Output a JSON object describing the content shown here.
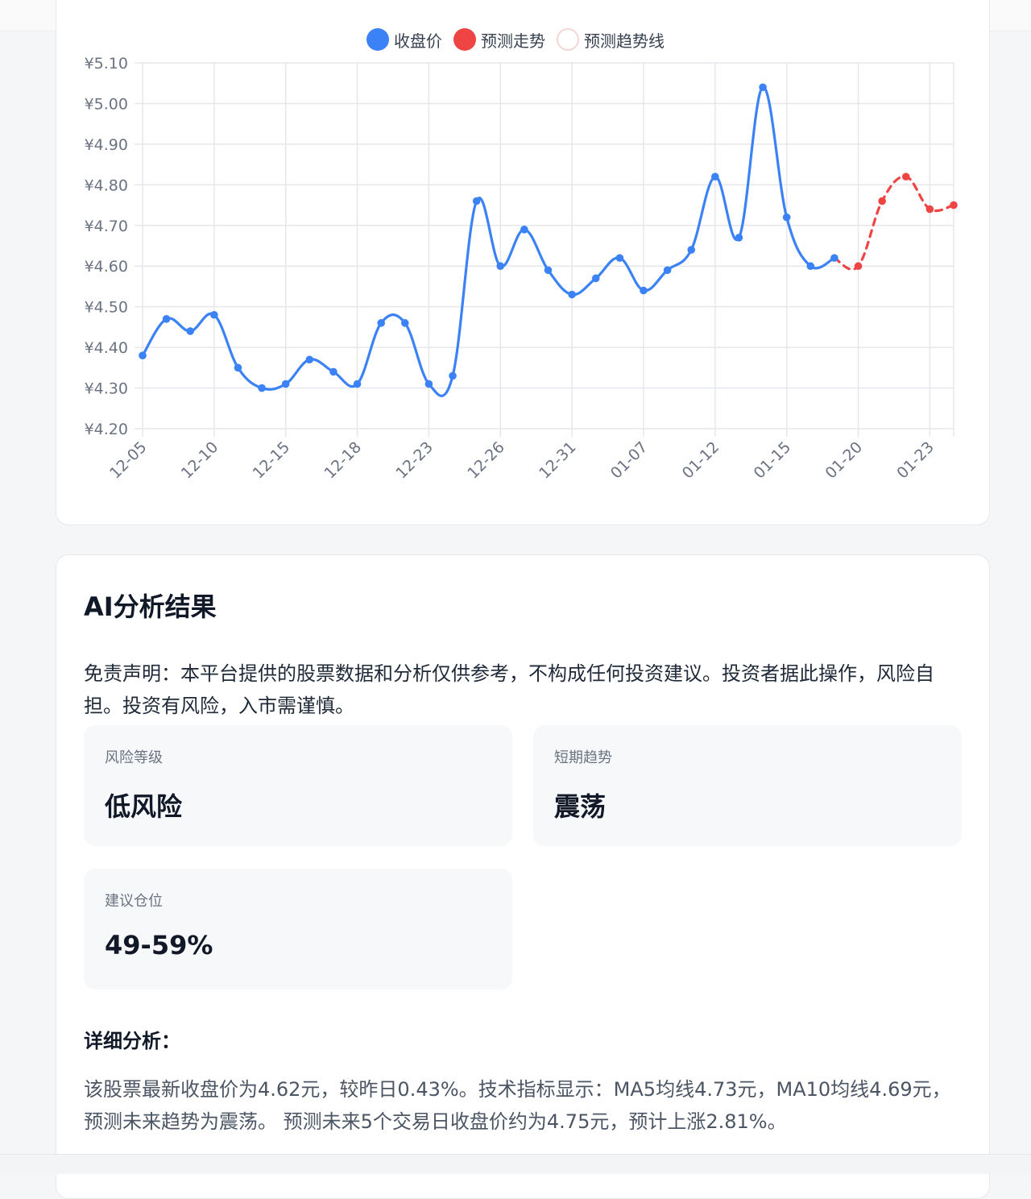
{
  "legend": {
    "items": [
      {
        "label": "收盘价",
        "color": "#3b82f6",
        "style": "filled"
      },
      {
        "label": "预测走势",
        "color": "#ef4444",
        "style": "filled"
      },
      {
        "label": "预测趋势线",
        "color": "#f3d6d6",
        "style": "hollow"
      }
    ]
  },
  "chart_data": {
    "type": "line",
    "ylim": [
      4.2,
      5.1
    ],
    "y_ticks": [
      "¥4.20",
      "¥4.30",
      "¥4.40",
      "¥4.50",
      "¥4.60",
      "¥4.70",
      "¥4.80",
      "¥4.90",
      "¥5.00",
      "¥5.10"
    ],
    "x_tick_labels": [
      "12-05",
      "12-10",
      "12-15",
      "12-18",
      "12-23",
      "12-26",
      "12-31",
      "01-07",
      "01-12",
      "01-15",
      "01-20",
      "01-23"
    ],
    "x_tick_positions": [
      0,
      3,
      6,
      9,
      12,
      15,
      18,
      21,
      24,
      27,
      30,
      33
    ],
    "x_count": 35,
    "grid": true,
    "legend_position": "top",
    "series": [
      {
        "name": "收盘价",
        "color": "#3b82f6",
        "dashed": false,
        "start_index": 0,
        "values": [
          4.38,
          4.47,
          4.44,
          4.48,
          4.35,
          4.3,
          4.31,
          4.37,
          4.34,
          4.31,
          4.46,
          4.46,
          4.31,
          4.33,
          4.76,
          4.6,
          4.69,
          4.59,
          4.53,
          4.57,
          4.62,
          4.54,
          4.59,
          4.64,
          4.82,
          4.67,
          5.04,
          4.72,
          4.6,
          4.62
        ]
      },
      {
        "name": "预测走势",
        "color": "#ef4444",
        "dashed": true,
        "start_index": 29,
        "values": [
          4.62,
          4.6,
          4.76,
          4.82,
          4.74,
          4.75
        ]
      }
    ]
  },
  "analysis": {
    "title": "AI分析结果",
    "disclaimer": "免责声明：本平台提供的股票数据和分析仅供参考，不构成任何投资建议。投资者据此操作，风险自担。投资有风险，入市需谨慎。",
    "metrics": [
      {
        "label": "风险等级",
        "value": "低风险"
      },
      {
        "label": "短期趋势",
        "value": "震荡"
      },
      {
        "label": "建议仓位",
        "value": "49-59%"
      }
    ],
    "detail_title": "详细分析：",
    "detail_text": "该股票最新收盘价为4.62元，较昨日0.43%。技术指标显示：MA5均线4.73元，MA10均线4.69元，预测未来趋势为震荡。 预测未来5个交易日收盘价约为4.75元，预计上涨2.81%。"
  }
}
